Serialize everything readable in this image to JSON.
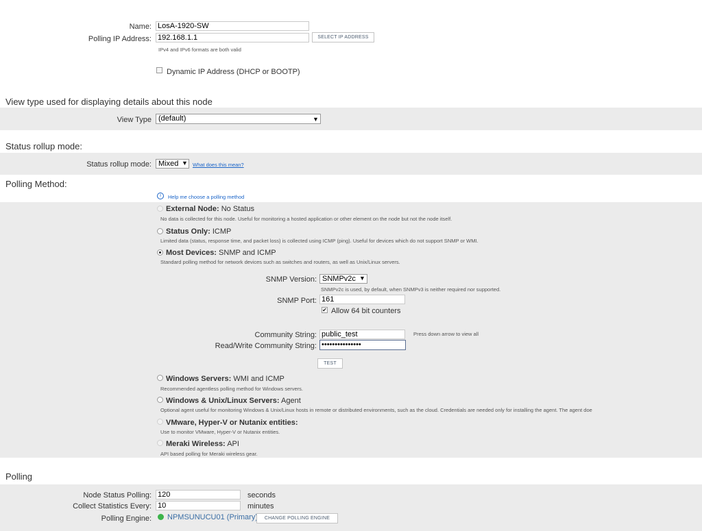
{
  "node": {
    "name_label": "Name:",
    "name_value": "LosA-1920-SW",
    "ip_label": "Polling IP Address:",
    "ip_value": "192.168.1.1",
    "select_ip_button": "SELECT IP ADDRESS",
    "ip_hint": "IPv4 and IPv6 formats are both valid",
    "dynamic_ip_label": "Dynamic IP Address (DHCP or BOOTP)",
    "dynamic_ip_checked": false
  },
  "view_type": {
    "section_title": "View type used for displaying details about this node",
    "label": "View Type",
    "value": "(default)"
  },
  "status_rollup": {
    "section_title": "Status rollup mode:",
    "label": "Status rollup mode:",
    "value": "Mixed",
    "help_link": "What does this mean?"
  },
  "polling_method": {
    "section_title": "Polling Method:",
    "help_link": "Help me choose a polling method",
    "options": [
      {
        "title": "External Node:",
        "subtitle": "No Status",
        "description": "No data is collected for this node. Useful for monitoring a hosted application or other element on the node but not the node itself.",
        "state": "disabled"
      },
      {
        "title": "Status Only:",
        "subtitle": "ICMP",
        "description": "Limited data (status, response time, and packet loss) is collected using ICMP (ping). Useful for devices which do not support SNMP or WMI.",
        "state": "unchecked"
      },
      {
        "title": "Most Devices:",
        "subtitle": "SNMP and ICMP",
        "description": "Standard polling method for network devices such as switches and routers, as well as Unix/Linux servers.",
        "state": "checked"
      },
      {
        "title": "Windows Servers:",
        "subtitle": "WMI and ICMP",
        "description": "Recommended agentless polling method for Windows servers.",
        "state": "unchecked"
      },
      {
        "title": "Windows & Unix/Linux Servers:",
        "subtitle": "Agent",
        "description": "Optional agent useful for monitoring Windows & Unix/Linux hosts in remote or distributed environments, such as the cloud. Credentials are needed only for installing the agent. The agent doe",
        "state": "unchecked"
      },
      {
        "title": "VMware, Hyper-V or Nutanix entities:",
        "subtitle": "",
        "description": "Use to monitor VMware, Hyper-V or Nutanix entities.",
        "state": "disabled"
      },
      {
        "title": "Meraki Wireless:",
        "subtitle": "API",
        "description": "API based polling for Meraki wireless gear.",
        "state": "disabled"
      }
    ],
    "snmp": {
      "version_label": "SNMP Version:",
      "version_value": "SNMPv2c",
      "version_hint": "SNMPv2c is used, by default, when SNMPv3 is neither required nor supported.",
      "port_label": "SNMP Port:",
      "port_value": "161",
      "allow64_label": "Allow 64 bit counters",
      "allow64_checked": true,
      "community_label": "Community String:",
      "community_value": "public_test",
      "community_hint": "Press down arrow to view all",
      "rw_community_label": "Read/Write Community String:",
      "rw_community_value": "•••••••••••••••",
      "test_button": "TEST"
    }
  },
  "polling": {
    "section_title": "Polling",
    "node_status_label": "Node Status Polling:",
    "node_status_value": "120",
    "node_status_unit": "seconds",
    "collect_stats_label": "Collect Statistics Every:",
    "collect_stats_value": "10",
    "collect_stats_unit": "minutes",
    "engine_label": "Polling Engine:",
    "engine_value": "NPMSUNUCU01 (Primary)",
    "engine_status_color": "#3cb44b",
    "change_engine_button": "CHANGE POLLING ENGINE"
  }
}
